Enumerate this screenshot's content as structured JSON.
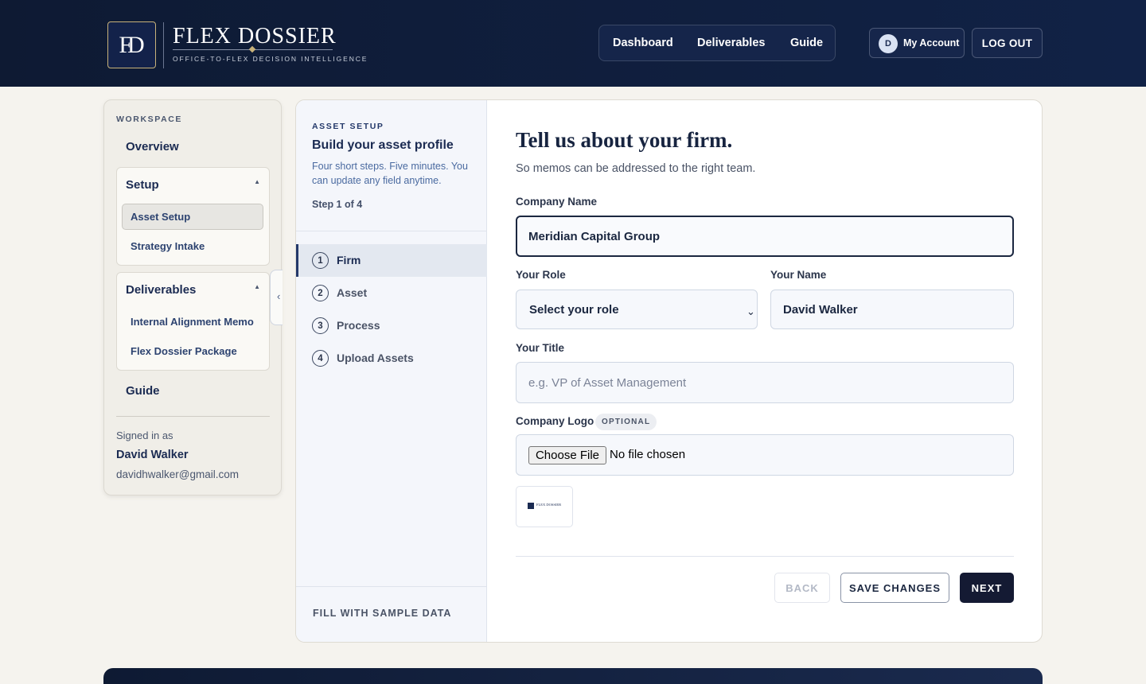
{
  "brand": {
    "mark": "FD",
    "title": "FLEX DOSSIER",
    "tagline": "OFFICE-TO-FLEX DECISION INTELLIGENCE"
  },
  "nav": {
    "dashboard": "Dashboard",
    "deliverables": "Deliverables",
    "guide": "Guide"
  },
  "account": {
    "avatar_initial": "D",
    "label": "My Account",
    "logout": "LOG OUT"
  },
  "sidebar": {
    "workspace_label": "WORKSPACE",
    "overview": "Overview",
    "setup": {
      "heading": "Setup",
      "items": [
        "Asset Setup",
        "Strategy Intake"
      ]
    },
    "deliverables": {
      "heading": "Deliverables",
      "items": [
        "Internal Alignment Memo",
        "Flex Dossier Package"
      ]
    },
    "guide": "Guide",
    "signed_in_label": "Signed in as",
    "user_name": "David Walker",
    "user_email": "davidhwalker@gmail.com"
  },
  "steps_panel": {
    "section_label": "ASSET SETUP",
    "title": "Build your asset profile",
    "description": "Four short steps. Five minutes. You can update any field anytime.",
    "step_indicator": "Step 1 of 4",
    "steps": [
      {
        "num": "1",
        "name": "Firm"
      },
      {
        "num": "2",
        "name": "Asset"
      },
      {
        "num": "3",
        "name": "Process"
      },
      {
        "num": "4",
        "name": "Upload Assets"
      }
    ],
    "fill_sample": "FILL WITH SAMPLE DATA"
  },
  "form": {
    "title": "Tell us about your firm.",
    "subtitle": "So memos can be addressed to the right team.",
    "company_name": {
      "label": "Company Name",
      "value": "Meridian Capital Group"
    },
    "role": {
      "label": "Your Role",
      "selected": "Select your role"
    },
    "name": {
      "label": "Your Name",
      "value": "David Walker"
    },
    "title_field": {
      "label": "Your Title",
      "placeholder": "e.g. VP of Asset Management"
    },
    "logo": {
      "label": "Company Logo",
      "badge": "OPTIONAL",
      "button": "Choose File",
      "status": "No file chosen",
      "thumb_text": "FLEX DOSSIER"
    },
    "buttons": {
      "back": "BACK",
      "save": "SAVE CHANGES",
      "next": "NEXT"
    }
  },
  "colors": {
    "header_bg": "#0e1a33",
    "accent_gold": "#c8b27a",
    "primary_dark": "#141a33",
    "page_bg": "#f5f3ee"
  }
}
